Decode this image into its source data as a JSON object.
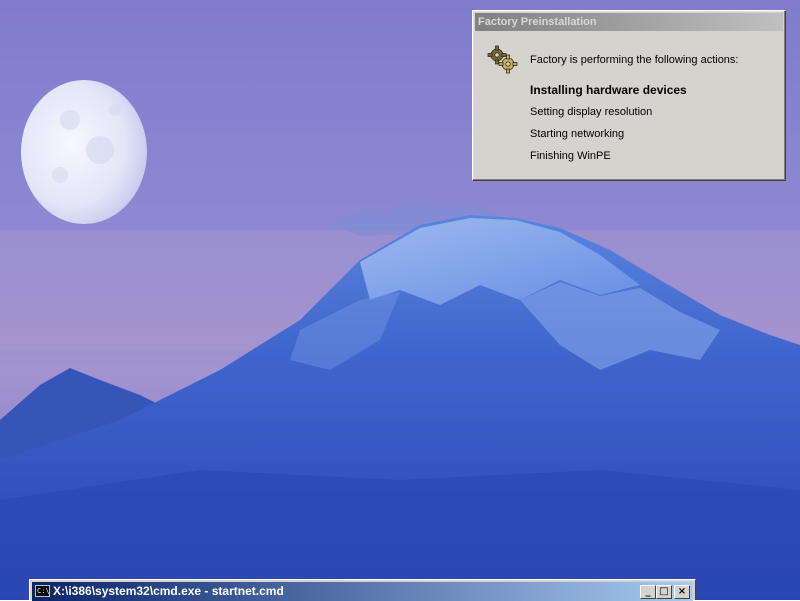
{
  "dialog": {
    "title": "Factory Preinstallation",
    "icon": "gears-icon",
    "intro": "Factory is performing the following actions:",
    "actions": [
      {
        "label": "Installing hardware devices",
        "state": "current"
      },
      {
        "label": "Setting display resolution",
        "state": "pending"
      },
      {
        "label": "Starting networking",
        "state": "pending"
      },
      {
        "label": "Finishing WinPE",
        "state": "pending"
      }
    ]
  },
  "cmd_window": {
    "title": "X:\\i386\\system32\\cmd.exe - startnet.cmd",
    "icon_text": "C:\\",
    "minimize_label": "_",
    "maximize_label": "□",
    "close_label": "×"
  },
  "colors": {
    "sky_top": "#8a87d2",
    "sky_bottom": "#9a8fcf",
    "mountain": "#3a5bc4",
    "dialog_bg": "#d6d3ce",
    "cmd_title_start": "#0a246a",
    "cmd_title_end": "#a6caf0"
  }
}
